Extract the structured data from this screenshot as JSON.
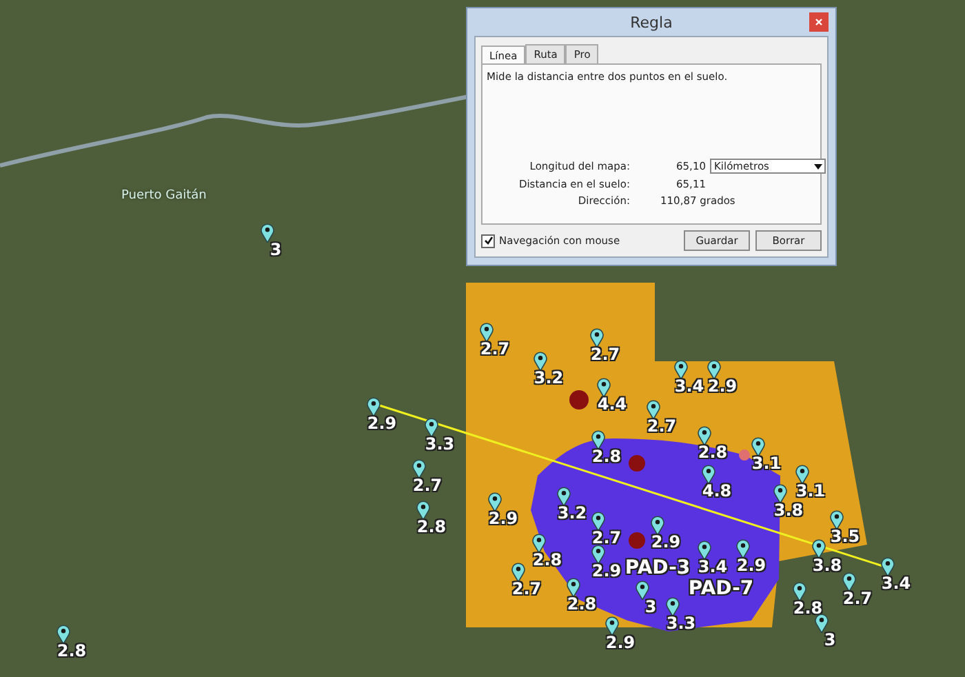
{
  "map": {
    "place_label": "Puerto Gaitán",
    "markers": [
      {
        "kind": "pin",
        "label": "3"
      },
      {
        "kind": "pin",
        "label": "2.7"
      },
      {
        "kind": "pin",
        "label": "2.7"
      },
      {
        "kind": "pin",
        "label": "3.2"
      },
      {
        "kind": "pin",
        "label": "3.4"
      },
      {
        "kind": "pin",
        "label": "2.9"
      },
      {
        "kind": "pin",
        "label": "4.4"
      },
      {
        "kind": "pin",
        "label": "2.9"
      },
      {
        "kind": "pin",
        "label": "2.7"
      },
      {
        "kind": "pin",
        "label": "3.3"
      },
      {
        "kind": "pin",
        "label": "2.8"
      },
      {
        "kind": "pin",
        "label": "2.8"
      },
      {
        "kind": "pin",
        "label": "3.1"
      },
      {
        "kind": "pin",
        "label": "2.7"
      },
      {
        "kind": "pin",
        "label": "4.8"
      },
      {
        "kind": "pin",
        "label": "3.1"
      },
      {
        "kind": "pin",
        "label": "2.8"
      },
      {
        "kind": "pin",
        "label": "2.9"
      },
      {
        "kind": "pin",
        "label": "3.2"
      },
      {
        "kind": "pin",
        "label": "3.8"
      },
      {
        "kind": "pin",
        "label": "2.7"
      },
      {
        "kind": "pin",
        "label": "2.9"
      },
      {
        "kind": "pin",
        "label": "3.5"
      },
      {
        "kind": "pin",
        "label": "2.8"
      },
      {
        "kind": "pin",
        "label": "2.9"
      },
      {
        "kind": "area",
        "label": "PAD-3"
      },
      {
        "kind": "pin",
        "label": "3.4"
      },
      {
        "kind": "pin",
        "label": "2.9"
      },
      {
        "kind": "pin",
        "label": "3.8"
      },
      {
        "kind": "pin",
        "label": "2.7"
      },
      {
        "kind": "pin",
        "label": "2.8"
      },
      {
        "kind": "pin",
        "label": "3"
      },
      {
        "kind": "area",
        "label": "PAD-7"
      },
      {
        "kind": "pin",
        "label": "2.8"
      },
      {
        "kind": "pin",
        "label": "2.7"
      },
      {
        "kind": "pin",
        "label": "3.4"
      },
      {
        "kind": "pin",
        "label": "3.3"
      },
      {
        "kind": "pin",
        "label": "2.8"
      },
      {
        "kind": "pin",
        "label": "2.9"
      },
      {
        "kind": "pin",
        "label": "3"
      }
    ]
  },
  "dialog": {
    "title": "Regla",
    "tabs": [
      {
        "label": "Línea",
        "selected": true
      },
      {
        "label": "Ruta",
        "selected": false
      },
      {
        "label": "Pro",
        "selected": false
      }
    ],
    "description": "Mide la distancia entre dos puntos en el suelo.",
    "map_length": {
      "label": "Longitud del mapa:",
      "value": "65,10",
      "unit": "Kilómetros"
    },
    "ground_distance": {
      "label": "Distancia en el suelo:",
      "value": "65,11"
    },
    "heading": {
      "label": "Dirección:",
      "value": "110,87 grados"
    },
    "mouse_navigation": {
      "label": "Navegación con mouse",
      "checked": true
    },
    "buttons": [
      "Guardar",
      "Borrar"
    ]
  }
}
